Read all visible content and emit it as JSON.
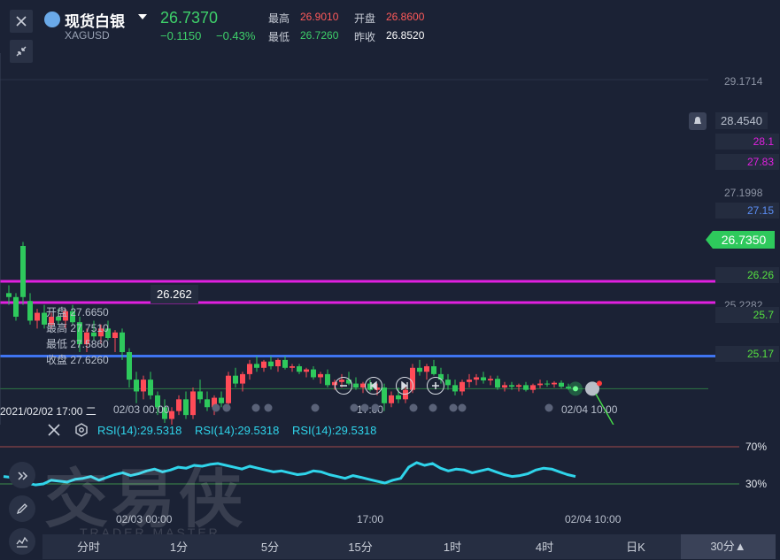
{
  "header": {
    "title": "现货白银",
    "symbol": "XAGUSD",
    "price": "26.7370",
    "change": "−0.1150",
    "change_pct": "−0.43%",
    "high_label": "最高",
    "high": "26.9010",
    "open_label": "开盘",
    "open": "26.8600",
    "low_label": "最低",
    "low": "26.7260",
    "prev_close_label": "昨收",
    "prev_close": "26.8520"
  },
  "price_axis": {
    "top": "29.1714",
    "alert": "28.4540",
    "mid": "27.1998",
    "low": "25.2282",
    "current": "26.7350"
  },
  "levels": [
    {
      "value": 28.1,
      "label": "28.1",
      "color": "#e020e0"
    },
    {
      "value": 27.83,
      "label": "27.83",
      "color": "#e020e0"
    },
    {
      "value": 27.15,
      "label": "27.15",
      "color": "#3f74f0"
    },
    {
      "value": 26.26,
      "label": "26.26",
      "color": "#55e040"
    },
    {
      "value": 25.7,
      "label": "25.7",
      "color": "#55e040"
    },
    {
      "value": 25.17,
      "label": "25.17",
      "color": "#55e040"
    }
  ],
  "low_marker": "26.262",
  "ohlc": {
    "open": "开盘 27.6650",
    "high": "最高 27.7510",
    "low": "最低 27.5860",
    "close": "收盘 27.6260"
  },
  "timeline": {
    "t1": "2021/02/02 17:00 二",
    "t2": "02/03 00:00",
    "t3": "17:00",
    "t4": "02/04 10:00"
  },
  "rsi": {
    "label1": "RSI(14):29.5318",
    "label2": "RSI(14):29.5318",
    "label3": "RSI(14):29.5318",
    "high_ref": "70%",
    "low_ref": "30%",
    "t1": "02/03 00:00",
    "t2": "17:00",
    "t3": "02/04 10:00",
    "values": [
      38,
      37,
      30,
      31,
      29,
      30,
      34,
      33,
      32,
      35,
      36,
      38,
      34,
      37,
      40,
      42,
      39,
      41,
      44,
      46,
      43,
      45,
      48,
      47,
      50,
      49,
      51,
      52,
      50,
      48,
      46,
      49,
      47,
      45,
      43,
      44,
      42,
      40,
      41,
      44,
      43,
      40,
      38,
      36,
      39,
      37,
      35,
      33,
      31,
      34,
      36,
      48,
      53,
      50,
      52,
      47,
      44,
      46,
      45,
      42,
      44,
      46,
      43,
      40,
      38,
      39,
      41,
      45,
      47,
      46,
      43,
      40,
      38
    ]
  },
  "watermark": {
    "cn": "交易侠",
    "en": "TRADER MASTER"
  },
  "tabs": [
    "分时",
    "1分",
    "5分",
    "15分",
    "1时",
    "4时",
    "日K",
    "30分▲"
  ],
  "candles": [
    [
      10,
      27.95,
      28.05,
      27.8,
      27.9
    ],
    [
      18,
      27.9,
      27.95,
      27.6,
      27.65
    ],
    [
      26,
      28.55,
      28.6,
      27.8,
      27.9
    ],
    [
      34,
      27.85,
      27.95,
      27.55,
      27.6
    ],
    [
      42,
      27.6,
      27.75,
      27.5,
      27.7
    ],
    [
      50,
      27.7,
      27.8,
      27.5,
      27.55
    ],
    [
      58,
      27.55,
      27.7,
      27.5,
      27.65
    ],
    [
      66,
      27.65,
      27.75,
      27.55,
      27.6
    ],
    [
      74,
      27.6,
      27.75,
      27.5,
      27.72
    ],
    [
      82,
      27.72,
      27.8,
      27.55,
      27.58
    ],
    [
      90,
      27.58,
      27.65,
      27.2,
      27.3
    ],
    [
      98,
      27.3,
      27.5,
      27.2,
      27.45
    ],
    [
      106,
      27.45,
      27.6,
      27.35,
      27.4
    ],
    [
      114,
      27.4,
      27.55,
      27.3,
      27.5
    ],
    [
      122,
      27.5,
      27.6,
      27.35,
      27.38
    ],
    [
      130,
      27.38,
      27.48,
      27.2,
      27.45
    ],
    [
      138,
      27.45,
      27.5,
      27.1,
      27.2
    ],
    [
      146,
      27.2,
      27.25,
      26.75,
      26.85
    ],
    [
      154,
      26.85,
      26.95,
      26.55,
      26.7
    ],
    [
      162,
      26.7,
      26.9,
      26.6,
      26.85
    ],
    [
      170,
      26.85,
      26.95,
      26.6,
      26.65
    ],
    [
      178,
      26.65,
      26.7,
      26.4,
      26.5
    ],
    [
      186,
      26.5,
      26.6,
      26.3,
      26.35
    ],
    [
      194,
      26.35,
      26.5,
      26.25,
      26.45
    ],
    [
      202,
      26.45,
      26.65,
      26.4,
      26.6
    ],
    [
      210,
      26.6,
      26.7,
      26.35,
      26.4
    ],
    [
      218,
      26.4,
      26.75,
      26.35,
      26.7
    ],
    [
      226,
      26.7,
      26.85,
      26.55,
      26.6
    ],
    [
      234,
      26.6,
      26.7,
      26.45,
      26.5
    ],
    [
      242,
      26.5,
      26.65,
      26.4,
      26.62
    ],
    [
      250,
      26.62,
      26.7,
      26.5,
      26.55
    ],
    [
      258,
      26.55,
      26.95,
      26.5,
      26.9
    ],
    [
      266,
      26.9,
      27.0,
      26.75,
      26.8
    ],
    [
      274,
      26.8,
      26.95,
      26.7,
      26.92
    ],
    [
      282,
      26.92,
      27.1,
      26.85,
      27.05
    ],
    [
      290,
      27.05,
      27.15,
      26.95,
      27.0
    ],
    [
      298,
      27.0,
      27.1,
      26.95,
      27.08
    ],
    [
      306,
      27.08,
      27.15,
      26.98,
      27.02
    ],
    [
      314,
      27.02,
      27.12,
      26.95,
      27.1
    ],
    [
      322,
      27.1,
      27.15,
      26.98,
      27.0
    ],
    [
      330,
      27.0,
      27.05,
      26.95,
      27.02
    ],
    [
      338,
      27.02,
      27.05,
      26.92,
      26.95
    ],
    [
      346,
      26.95,
      27.0,
      26.88,
      26.98
    ],
    [
      354,
      26.98,
      27.02,
      26.85,
      26.88
    ],
    [
      362,
      26.88,
      26.95,
      26.8,
      26.92
    ],
    [
      370,
      26.92,
      26.98,
      26.75,
      26.78
    ],
    [
      378,
      26.78,
      26.85,
      26.72,
      26.82
    ],
    [
      386,
      26.82,
      26.92,
      26.75,
      26.85
    ],
    [
      394,
      26.85,
      26.95,
      26.78,
      26.8
    ],
    [
      402,
      26.8,
      26.88,
      26.72,
      26.75
    ],
    [
      410,
      26.75,
      26.82,
      26.68,
      26.8
    ],
    [
      418,
      26.8,
      26.85,
      26.7,
      26.72
    ],
    [
      426,
      26.72,
      26.8,
      26.65,
      26.75
    ],
    [
      434,
      26.75,
      26.8,
      26.45,
      26.55
    ],
    [
      442,
      26.55,
      26.7,
      26.5,
      26.65
    ],
    [
      450,
      26.65,
      26.75,
      26.55,
      26.6
    ],
    [
      458,
      26.6,
      26.78,
      26.55,
      26.72
    ],
    [
      466,
      26.72,
      27.05,
      26.68,
      27.0
    ],
    [
      474,
      27.0,
      27.1,
      26.9,
      26.95
    ],
    [
      482,
      26.95,
      27.05,
      26.85,
      27.02
    ],
    [
      490,
      27.02,
      27.1,
      26.9,
      26.92
    ],
    [
      498,
      26.92,
      27.0,
      26.8,
      26.85
    ],
    [
      506,
      26.85,
      26.92,
      26.72,
      26.78
    ],
    [
      514,
      26.78,
      26.85,
      26.65,
      26.7
    ],
    [
      522,
      26.7,
      26.85,
      26.65,
      26.82
    ],
    [
      530,
      26.82,
      26.92,
      26.75,
      26.85
    ],
    [
      538,
      26.85,
      26.92,
      26.78,
      26.88
    ],
    [
      546,
      26.88,
      26.95,
      26.8,
      26.84
    ],
    [
      554,
      26.84,
      26.9,
      26.78,
      26.86
    ],
    [
      562,
      26.86,
      26.9,
      26.72,
      26.75
    ],
    [
      570,
      26.75,
      26.82,
      26.7,
      26.78
    ],
    [
      578,
      26.78,
      26.82,
      26.72,
      26.76
    ],
    [
      586,
      26.76,
      26.8,
      26.7,
      26.78
    ],
    [
      594,
      26.78,
      26.82,
      26.7,
      26.72
    ],
    [
      602,
      26.72,
      26.8,
      26.68,
      26.78
    ],
    [
      610,
      26.78,
      26.85,
      26.74,
      26.8
    ],
    [
      618,
      26.8,
      26.84,
      26.76,
      26.79
    ],
    [
      626,
      26.79,
      26.83,
      26.75,
      26.81
    ],
    [
      634,
      26.81,
      26.84,
      26.74,
      26.76
    ],
    [
      642,
      26.76,
      26.8,
      26.72,
      26.74
    ]
  ],
  "colors": {
    "bg": "#1b2235",
    "up": "#ff4b57",
    "down": "#2ec95c",
    "rsi": "#2fd4ea"
  }
}
